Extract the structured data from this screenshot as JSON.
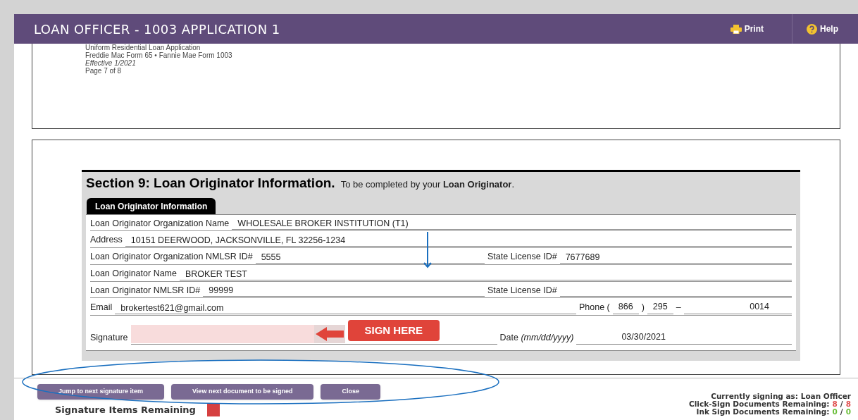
{
  "header": {
    "title": "LOAN OFFICER - 1003 APPLICATION 1",
    "actions": [
      {
        "kind": "print",
        "label": "Print"
      },
      {
        "kind": "help",
        "label": "Help"
      }
    ]
  },
  "page_top": {
    "lines": [
      {
        "text": "Uniform Residential Loan Application",
        "italic": false
      },
      {
        "text": "Freddie Mac Form 65 • Fannie Mae Form 1003",
        "italic": false
      },
      {
        "text": "Effective 1/2021",
        "italic": true
      },
      {
        "text": "Page 7 of 8",
        "italic": false
      }
    ]
  },
  "section": {
    "title": "Section 9: Loan Originator Information.",
    "subtitle": "To be completed by your **Loan Originator**.",
    "tab": "Loan Originator Information",
    "rows": [
      {
        "kind": "fields",
        "cells": [
          {
            "label": "Loan Originator Organization Name",
            "value": "WHOLESALE BROKER  INSTITUTION (T1)"
          }
        ]
      },
      {
        "kind": "fields",
        "cells": [
          {
            "label": "Address",
            "value": "10151 DEERWOOD, JACKSONVILLE, FL 32256-1234"
          }
        ]
      },
      {
        "kind": "fields",
        "cells": [
          {
            "label": "Loan Originator Organization NMLSR ID#",
            "value": "5555"
          },
          {
            "label": "State License ID#",
            "value": "7677689"
          }
        ]
      },
      {
        "kind": "fields",
        "cells": [
          {
            "label": "Loan Originator Name",
            "value": "BROKER TEST"
          }
        ]
      },
      {
        "kind": "fields",
        "cells": [
          {
            "label": "Loan Originator NMLSR ID#",
            "value": "99999"
          },
          {
            "label": "State License ID#"
          }
        ]
      },
      {
        "kind": "phone",
        "email_label": "Email",
        "email": "brokertest621@gmail.com",
        "phone_label": "Phone (",
        "area": "866",
        "close": ")",
        "prefix": "295",
        "dash": "–",
        "line": "0014"
      },
      {
        "kind": "signature",
        "label": "Signature",
        "sign_button": "SIGN HERE",
        "date_label": "Date *(mm/dd/yyyy)*",
        "date": "03/30/2021"
      }
    ]
  },
  "buttons": [
    {
      "label": "Jump to next signature item"
    },
    {
      "label": "View next document to be signed"
    },
    {
      "label": "Close"
    }
  ],
  "signature_items": {
    "label": "Signature Items Remaining"
  },
  "status": {
    "signing_as": "Currently signing as: Loan Officer",
    "counts": [
      {
        "label": "Click-Sign Documents Remaining:",
        "done": "8",
        "separator": "/",
        "total": "8",
        "color": "#e05050"
      },
      {
        "label": "Ink Sign Documents Remaining:",
        "done": "0",
        "separator": "/",
        "total": "0",
        "color": "#6cbf3c"
      }
    ]
  }
}
